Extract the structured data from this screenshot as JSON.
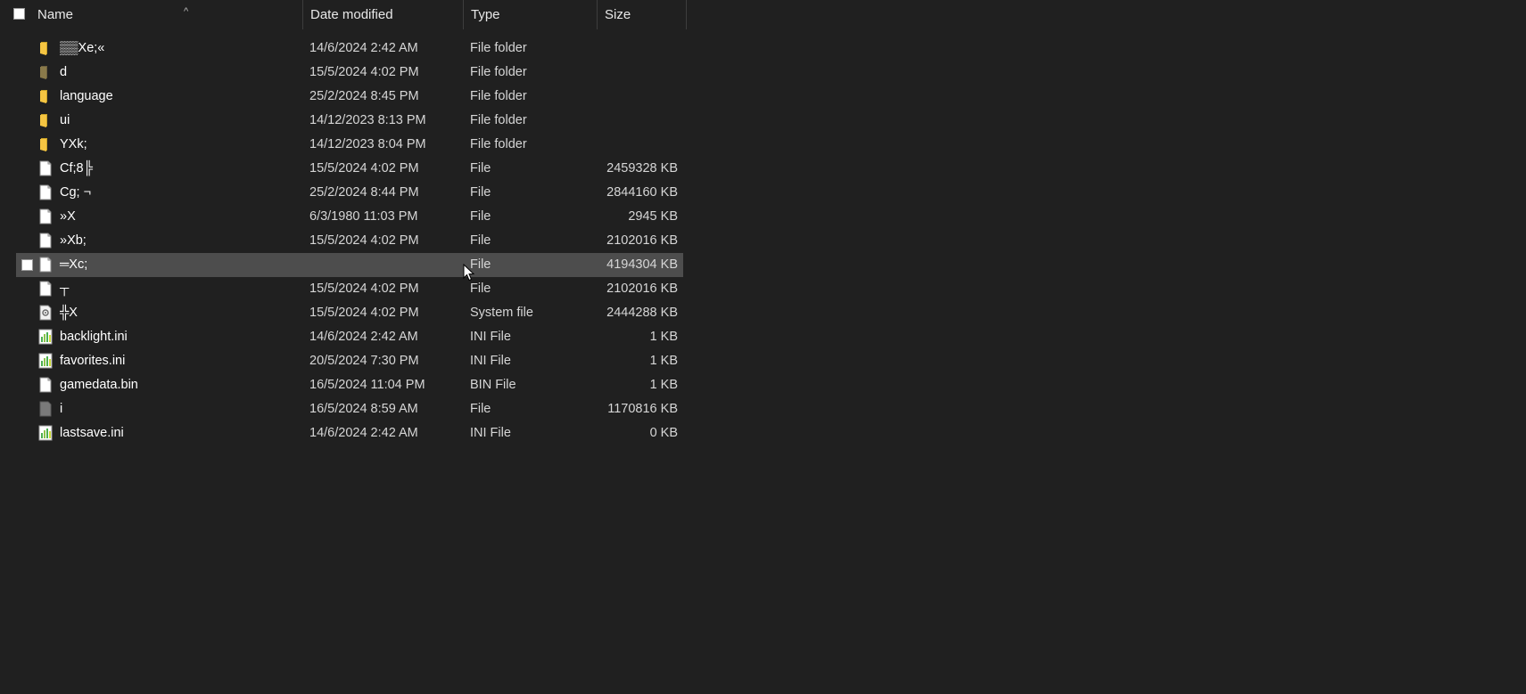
{
  "header": {
    "name": "Name",
    "date": "Date modified",
    "type": "Type",
    "size": "Size",
    "sort_arrow": "^"
  },
  "colors": {
    "background": "#202020",
    "hover_row": "#4d4d4d",
    "folder": "#f5c542",
    "folder_dark": "#8a7a4a",
    "ini_green": "#4caf50"
  },
  "rows": [
    {
      "name": "▒▒Xe;«",
      "date": "14/6/2024 2:42 AM",
      "type": "File folder",
      "size": "",
      "icon": "folder-icon"
    },
    {
      "name": "d",
      "date": "15/5/2024 4:02 PM",
      "type": "File folder",
      "size": "",
      "icon": "folder-dark-icon"
    },
    {
      "name": "language",
      "date": "25/2/2024 8:45 PM",
      "type": "File folder",
      "size": "",
      "icon": "folder-icon"
    },
    {
      "name": "ui",
      "date": "14/12/2023 8:13 PM",
      "type": "File folder",
      "size": "",
      "icon": "folder-icon"
    },
    {
      "name": "YXk;",
      "date": "14/12/2023 8:04 PM",
      "type": "File folder",
      "size": "",
      "icon": "folder-icon"
    },
    {
      "name": "Cf;8╠",
      "date": "15/5/2024 4:02 PM",
      "type": "File",
      "size": "2459328 KB",
      "icon": "file-icon"
    },
    {
      "name": "Cg; ¬",
      "date": "25/2/2024 8:44 PM",
      "type": "File",
      "size": "2844160 KB",
      "icon": "file-icon"
    },
    {
      "name": "»X",
      "date": "6/3/1980 11:03 PM",
      "type": "File",
      "size": "2945 KB",
      "icon": "file-icon"
    },
    {
      "name": "»Xb;",
      "date": "15/5/2024 4:02 PM",
      "type": "File",
      "size": "2102016 KB",
      "icon": "file-icon"
    },
    {
      "name": "═Xc;",
      "date": "",
      "type": "File",
      "size": "4194304 KB",
      "icon": "file-icon",
      "hover": true
    },
    {
      "name": "┬",
      "date": "15/5/2024 4:02 PM",
      "type": "File",
      "size": "2102016 KB",
      "icon": "file-icon"
    },
    {
      "name": "╬X",
      "date": "15/5/2024 4:02 PM",
      "type": "System file",
      "size": "2444288 KB",
      "icon": "system-file-icon"
    },
    {
      "name": "backlight.ini",
      "date": "14/6/2024 2:42 AM",
      "type": "INI File",
      "size": "1 KB",
      "icon": "ini-file-icon"
    },
    {
      "name": "favorites.ini",
      "date": "20/5/2024 7:30 PM",
      "type": "INI File",
      "size": "1 KB",
      "icon": "ini-file-icon"
    },
    {
      "name": "gamedata.bin",
      "date": "16/5/2024 11:04 PM",
      "type": "BIN File",
      "size": "1 KB",
      "icon": "file-icon"
    },
    {
      "name": "i",
      "date": "16/5/2024 8:59 AM",
      "type": "File",
      "size": "1170816 KB",
      "icon": "file-gray-icon"
    },
    {
      "name": "lastsave.ini",
      "date": "14/6/2024 2:42 AM",
      "type": "INI File",
      "size": "0 KB",
      "icon": "ini-file-icon"
    }
  ]
}
